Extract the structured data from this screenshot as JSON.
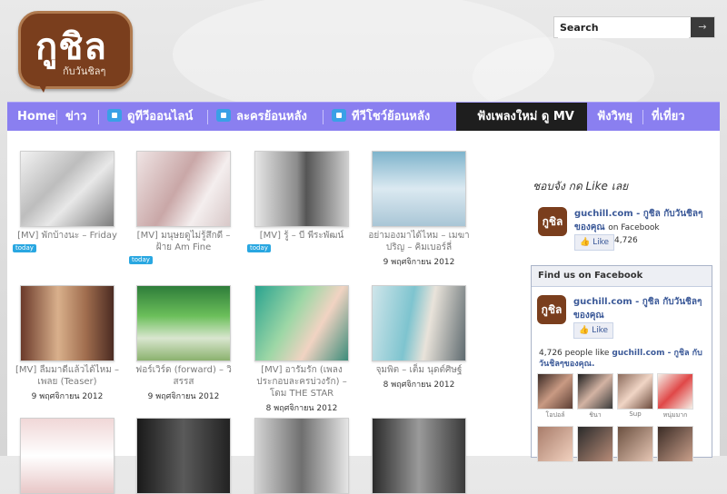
{
  "logo": {
    "main": "กูชิล",
    "sub": "กับวันชิลๆ"
  },
  "search": {
    "placeholder": "Search",
    "button_icon": "arrow-right-icon"
  },
  "nav": {
    "items": [
      {
        "label": "Home"
      },
      {
        "label": "ข่าว"
      },
      {
        "label": "ดูทีวีออนไลน์",
        "icon": "tv-icon"
      },
      {
        "label": "ละครย้อนหลัง",
        "icon": "theater-icon"
      },
      {
        "label": "ทีวีโชว์ย้อนหลัง",
        "icon": "video-camera-icon"
      },
      {
        "label": "ฟังเพลงใหม่ ดู MV",
        "active": true
      },
      {
        "label": "ฟังวิทยุ"
      },
      {
        "label": "ที่เที่ยว"
      }
    ],
    "colors": {
      "bar": "#8a7ff0",
      "active": "#1e1e1e",
      "icon": "#3aa0e6"
    }
  },
  "posts": [
    {
      "title": "[MV] พักบ้างนะ – Friday",
      "date": "",
      "badge": "today"
    },
    {
      "title": "[MV] มนุษยดูไม่รู้สึกดี – ฝ้าย Am Fine",
      "date": "",
      "badge": "today"
    },
    {
      "title": "[MV] รู้ – บี พีระพัฒน์",
      "date": "",
      "badge": "today"
    },
    {
      "title": "อย่ามองมาได้ไหม – เมฆา ปริญ – คิมเบอร์ลี่",
      "date": "9 พฤศจิกายน 2012",
      "badge": ""
    },
    {
      "title": "[MV] ลืมมาดีแล้วได้ไหม – เพลย (Teaser)",
      "date": "9 พฤศจิกายน 2012",
      "badge": ""
    },
    {
      "title": "ฟอร์เวิร์ด (forward) – วิสรรส",
      "date": "9 พฤศจิกายน 2012",
      "badge": ""
    },
    {
      "title": "[MV] อารัมรัก (เพลงประกอบละครบ่วงรัก) – โดม THE STAR",
      "date": "8 พฤศจิกายน 2012",
      "badge": ""
    },
    {
      "title": "จุมพิต – เต็ม นุดต์ศิษฐ์",
      "date": "8 พฤศจิกายน 2012",
      "badge": ""
    },
    {
      "title": "",
      "date": "",
      "badge": ""
    },
    {
      "title": "",
      "date": "",
      "badge": ""
    },
    {
      "title": "",
      "date": "",
      "badge": ""
    },
    {
      "title": "",
      "date": "",
      "badge": ""
    }
  ],
  "sidebar": {
    "heading": "ชอบจัง กด Like เลย",
    "mini": {
      "avatar": "กูชิล",
      "name": "guchill.com - กูชิล กับวันชิลๆของคุณ",
      "on": "on Facebook",
      "like": "Like",
      "count": "4,726"
    },
    "box": {
      "title": "Find us on Facebook",
      "avatar": "กูชิล",
      "name": "guchill.com - กูชิล กับวันชิลๆของคุณ",
      "like": "Like",
      "people_count": "4,726 people like",
      "people_page": "guchill.com - กูชิล กับวันชิลๆของคุณ.",
      "faces": [
        {
          "name": "โอปอล์"
        },
        {
          "name": "ชินา"
        },
        {
          "name": "Sup"
        },
        {
          "name": "หนุ่มมาก"
        },
        {
          "name": ""
        },
        {
          "name": ""
        },
        {
          "name": ""
        },
        {
          "name": ""
        }
      ]
    }
  }
}
